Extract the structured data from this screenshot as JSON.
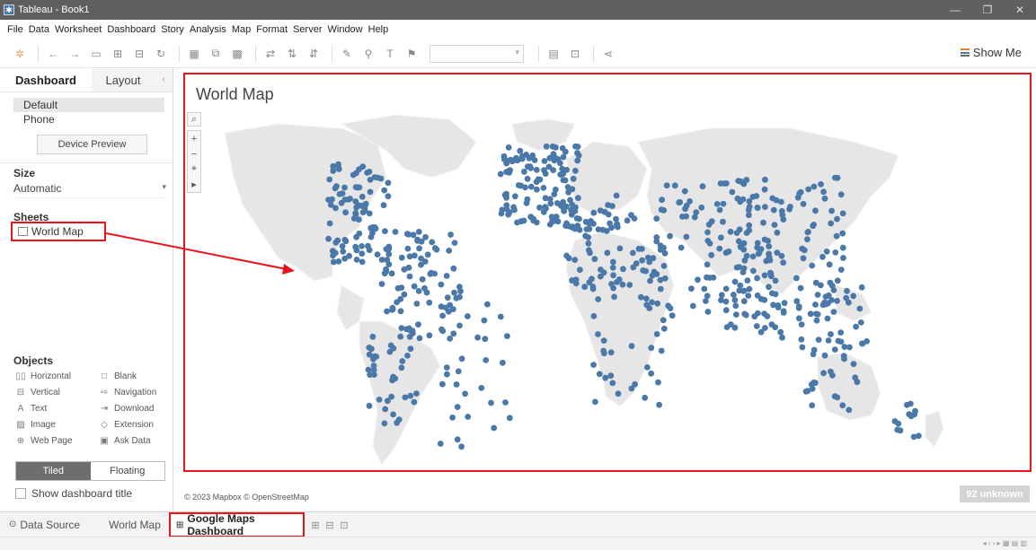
{
  "window": {
    "title": "Tableau - Book1"
  },
  "menu": [
    "File",
    "Data",
    "Worksheet",
    "Dashboard",
    "Story",
    "Analysis",
    "Map",
    "Format",
    "Server",
    "Window",
    "Help"
  ],
  "toolbar": {
    "show_me": "Show Me"
  },
  "sidebar": {
    "tabs": [
      "Dashboard",
      "Layout"
    ],
    "devices": [
      "Default",
      "Phone"
    ],
    "device_preview": "Device Preview",
    "size_title": "Size",
    "size_value": "Automatic",
    "sheets_title": "Sheets",
    "sheet_item": "World Map",
    "objects_title": "Objects",
    "objects": [
      {
        "label": "Horizontal",
        "icon": "horizontal-icon"
      },
      {
        "label": "Blank",
        "icon": "blank-icon"
      },
      {
        "label": "Vertical",
        "icon": "vertical-icon"
      },
      {
        "label": "Navigation",
        "icon": "navigation-icon"
      },
      {
        "label": "Text",
        "icon": "text-icon"
      },
      {
        "label": "Download",
        "icon": "download-icon"
      },
      {
        "label": "Image",
        "icon": "image-icon"
      },
      {
        "label": "Extension",
        "icon": "extension-icon"
      },
      {
        "label": "Web Page",
        "icon": "web-page-icon"
      },
      {
        "label": "Ask Data",
        "icon": "ask-data-icon"
      }
    ],
    "tiled": "Tiled",
    "floating": "Floating",
    "show_title": "Show dashboard title"
  },
  "canvas": {
    "map_title": "World Map",
    "attribution": "© 2023 Mapbox © OpenStreetMap",
    "unknown_badge": "92 unknown",
    "accent_color": "#e8131b",
    "dot_color": "#4a78a8"
  },
  "sheet_tabs": {
    "data_source": "Data Source",
    "world_map": "World Map",
    "active": "Google Maps Dashboard"
  }
}
